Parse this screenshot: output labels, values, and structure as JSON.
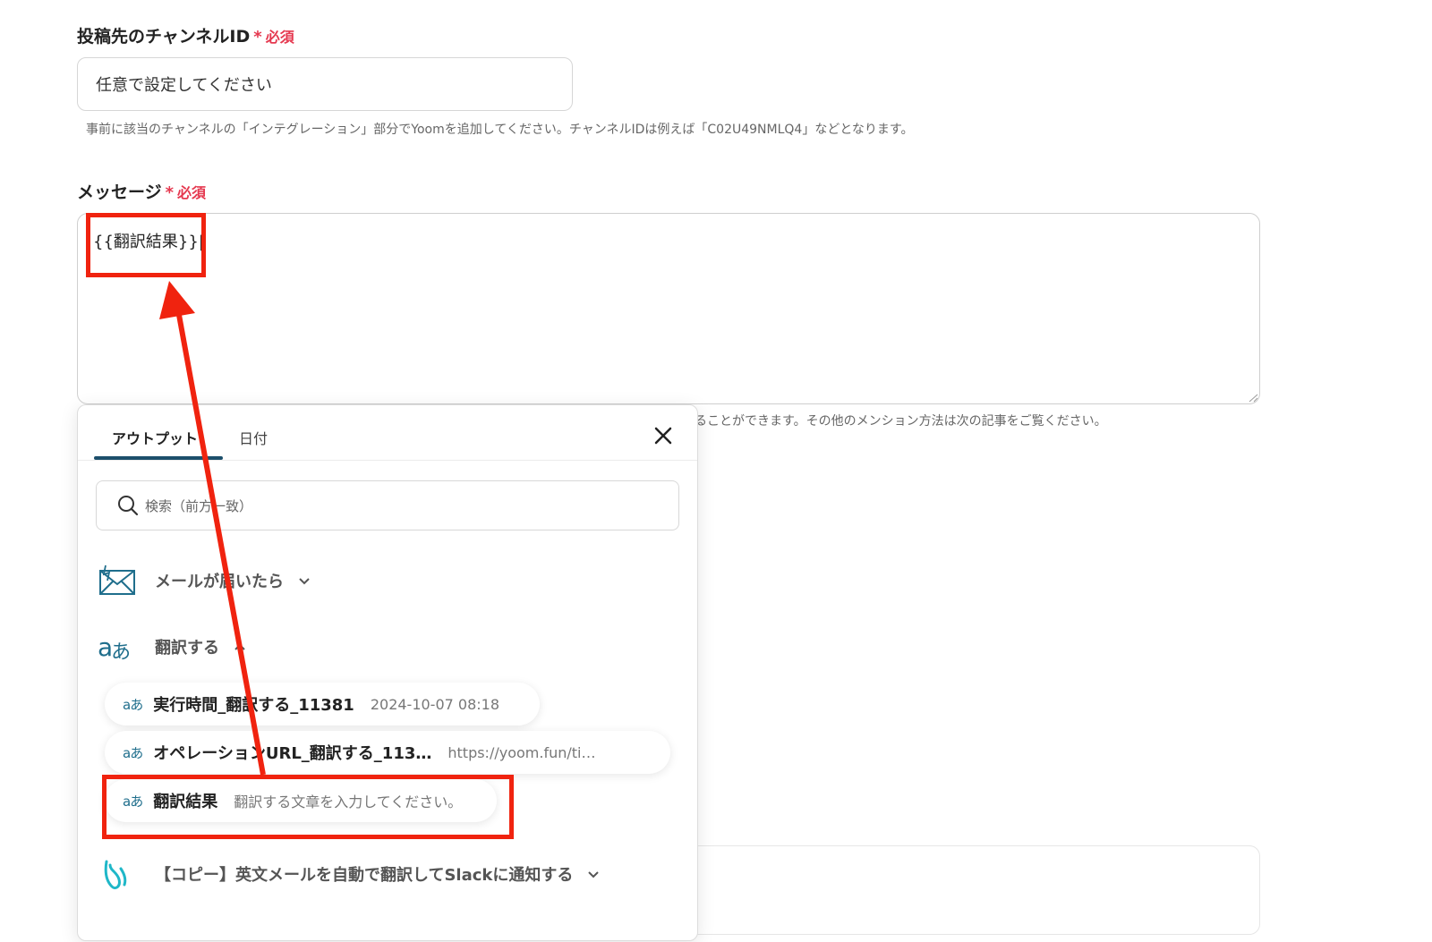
{
  "channel": {
    "label": "投稿先のチャンネルID",
    "required": "必須",
    "value": "任意で設定してください",
    "hint": "事前に該当のチャンネルの「インテグレーション」部分でYoomを追加してください。チャンネルIDは例えば「C02U49NMLQ4」などとなります。"
  },
  "message": {
    "label": "メッセージ",
    "required": "必須",
    "value": "{{翻訳結果}}|",
    "hint_partial": "ることができます。その他のメンション方法は次の記事をご覧ください。"
  },
  "panel": {
    "tabs": [
      {
        "label": "アウトプット",
        "active": true
      },
      {
        "label": "日付",
        "active": false
      }
    ],
    "search_placeholder": "検索（前方一致）",
    "groups": [
      {
        "label": "メールが届いたら",
        "icon": "mail-icon",
        "expanded": false
      },
      {
        "label": "翻訳する",
        "icon": "translate-icon",
        "expanded": true
      },
      {
        "label": "【コピー】英文メールを自動で翻訳してSlackに通知する",
        "icon": "yoom-logo-icon",
        "expanded": false
      }
    ],
    "items": [
      {
        "icon": "aあ",
        "name": "実行時間_翻訳する_11381",
        "value": "2024-10-07 08:18"
      },
      {
        "icon": "aあ",
        "name": "オペレーションURL_翻訳する_113…",
        "value": "https://yoom.fun/ti…"
      },
      {
        "icon": "aあ",
        "name": "翻訳結果",
        "value": "翻訳する文章を入力してください。"
      }
    ]
  },
  "colors": {
    "required": "#e5384f",
    "accent": "#1c4f6b",
    "annotation": "#f0230f"
  }
}
